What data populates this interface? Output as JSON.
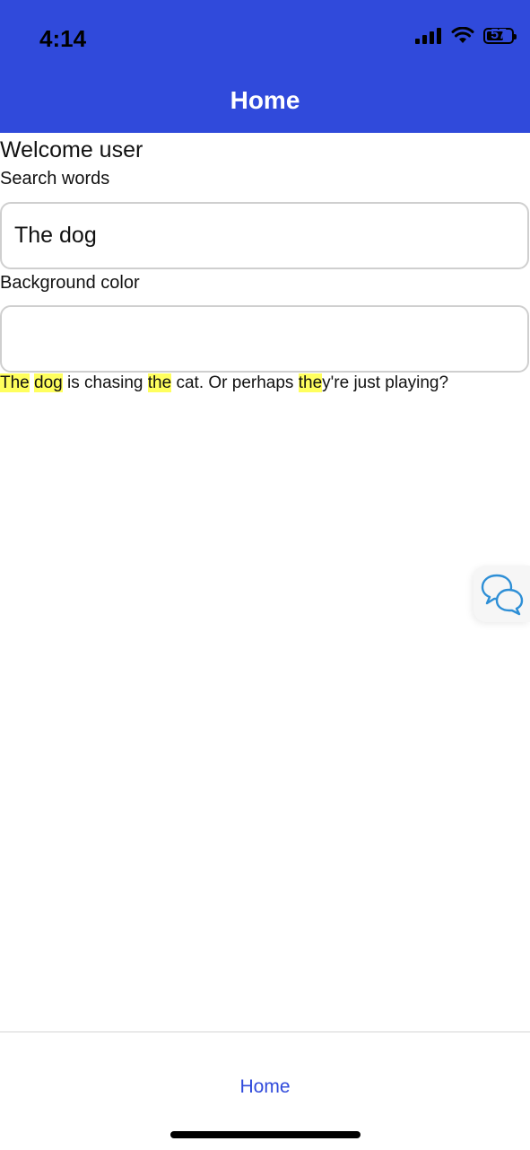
{
  "status_bar": {
    "time": "4:14",
    "battery_level": "57"
  },
  "header": {
    "title": "Home"
  },
  "main": {
    "welcome": "Welcome user",
    "search_label": "Search words",
    "search_value": "The dog",
    "bgcolor_label": "Background color",
    "bgcolor_value": "",
    "sentence": {
      "t1": "The",
      "t2": " ",
      "t3": "dog",
      "t4": " is chasing ",
      "t5": "the",
      "t6": " cat. Or perhaps ",
      "t7": "the",
      "t8": "y're just playing?"
    }
  },
  "chat_button": {
    "icon": "chat-bubbles-icon"
  },
  "tab_bar": {
    "home_label": "Home"
  },
  "colors": {
    "accent": "#304ADB",
    "highlight": "#FFFF5E",
    "chat_icon": "#2E8FD6"
  }
}
